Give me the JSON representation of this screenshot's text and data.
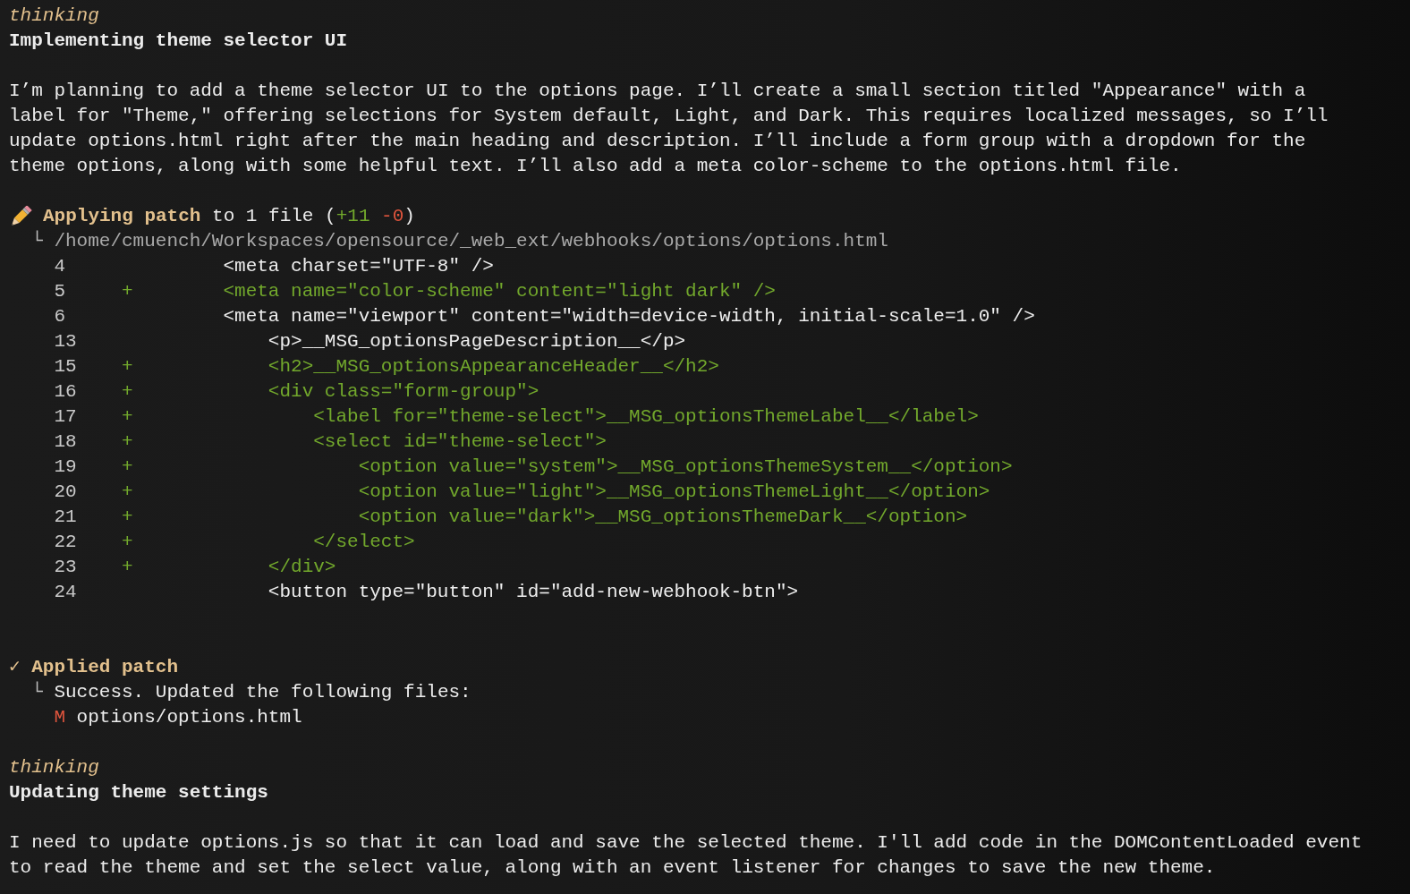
{
  "blocks": [
    {
      "kind": "thinking",
      "label": "thinking",
      "title": "Implementing theme selector UI",
      "paragraph": [
        "I’m planning to add a theme selector UI to the options page. I’ll create a small section titled \"Appearance\" with a",
        "label for \"Theme,\" offering selections for System default, Light, and Dark. This requires localized messages, so I’ll",
        "update options.html right after the main heading and description. I’ll include a form group with a dropdown for the",
        "theme options, along with some helpful text. I’ll also add a meta color-scheme to the options.html file."
      ]
    },
    {
      "kind": "patch",
      "title": "Applying patch",
      "summary": "to 1 file (",
      "added": "+11",
      "removed": "-0",
      "summary_end": ")",
      "branch": "└",
      "path": "/home/cmuench/Workspaces/opensource/_web_ext/webhooks/options/options.html",
      "lines": [
        {
          "number": "4",
          "added": false,
          "code": "<meta charset=\"UTF-8\" />"
        },
        {
          "number": "5",
          "added": true,
          "marker": "+",
          "code": "<meta name=\"color-scheme\" content=\"light dark\" />"
        },
        {
          "number": "6",
          "added": false,
          "code": "<meta name=\"viewport\" content=\"width=device-width, initial-scale=1.0\" />"
        },
        {
          "number": "13",
          "added": false,
          "code": "    <p>__MSG_optionsPageDescription__</p>"
        },
        {
          "number": "15",
          "added": true,
          "marker": "+",
          "code": "    <h2>__MSG_optionsAppearanceHeader__</h2>"
        },
        {
          "number": "16",
          "added": true,
          "marker": "+",
          "code": "    <div class=\"form-group\">"
        },
        {
          "number": "17",
          "added": true,
          "marker": "+",
          "code": "        <label for=\"theme-select\">__MSG_optionsThemeLabel__</label>"
        },
        {
          "number": "18",
          "added": true,
          "marker": "+",
          "code": "        <select id=\"theme-select\">"
        },
        {
          "number": "19",
          "added": true,
          "marker": "+",
          "code": "            <option value=\"system\">__MSG_optionsThemeSystem__</option>"
        },
        {
          "number": "20",
          "added": true,
          "marker": "+",
          "code": "            <option value=\"light\">__MSG_optionsThemeLight__</option>"
        },
        {
          "number": "21",
          "added": true,
          "marker": "+",
          "code": "            <option value=\"dark\">__MSG_optionsThemeDark__</option>"
        },
        {
          "number": "22",
          "added": true,
          "marker": "+",
          "code": "        </select>"
        },
        {
          "number": "23",
          "added": true,
          "marker": "+",
          "code": "    </div>"
        },
        {
          "number": "24",
          "added": false,
          "code": "    <button type=\"button\" id=\"add-new-webhook-btn\">"
        }
      ]
    },
    {
      "kind": "applied",
      "mark": "✓",
      "title": "Applied patch",
      "branch": "└",
      "message": "Success. Updated the following files:",
      "files": [
        {
          "status": "M",
          "path": "options/options.html"
        }
      ]
    },
    {
      "kind": "thinking",
      "label": "thinking",
      "title": "Updating theme settings",
      "paragraph": [
        "I need to update options.js so that it can load and save the selected theme. I'll add code in the DOMContentLoaded event",
        "to read the theme and set the select value, along with an event listener for changes to save the new theme."
      ]
    }
  ]
}
